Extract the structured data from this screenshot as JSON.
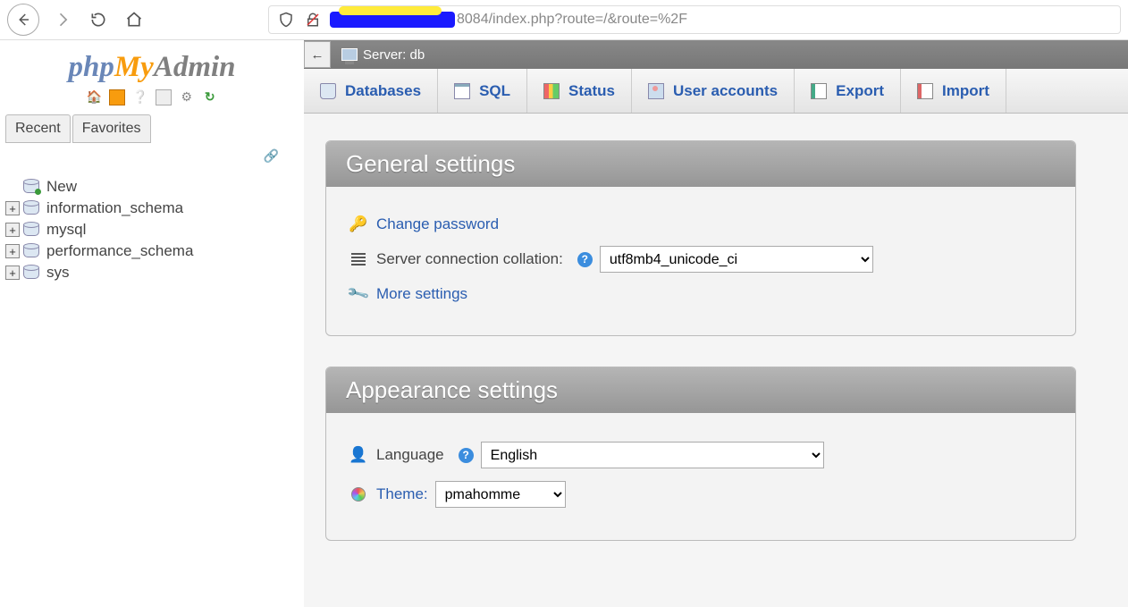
{
  "browser": {
    "url_suffix": "8084/index.php?route=/&route=%2F"
  },
  "logo": {
    "p1": "php",
    "p2": "My",
    "p3": "Admin"
  },
  "sidebar": {
    "tabs": {
      "recent": "Recent",
      "favorites": "Favorites"
    },
    "tree": [
      {
        "label": "New",
        "expandable": false,
        "new": true
      },
      {
        "label": "information_schema",
        "expandable": true
      },
      {
        "label": "mysql",
        "expandable": true
      },
      {
        "label": "performance_schema",
        "expandable": true
      },
      {
        "label": "sys",
        "expandable": true
      }
    ]
  },
  "crumb": {
    "server_label": "Server: db"
  },
  "top_tabs": [
    {
      "label": "Databases",
      "icon": "db"
    },
    {
      "label": "SQL",
      "icon": "sql"
    },
    {
      "label": "Status",
      "icon": "status"
    },
    {
      "label": "User accounts",
      "icon": "user"
    },
    {
      "label": "Export",
      "icon": "export"
    },
    {
      "label": "Import",
      "icon": "import"
    }
  ],
  "general": {
    "heading": "General settings",
    "change_pw": "Change password",
    "coll_label": "Server connection collation:",
    "coll_value": "utf8mb4_unicode_ci",
    "more": "More settings"
  },
  "appearance": {
    "heading": "Appearance settings",
    "lang_label": "Language",
    "lang_value": "English",
    "theme_label": "Theme:",
    "theme_value": "pmahomme"
  }
}
